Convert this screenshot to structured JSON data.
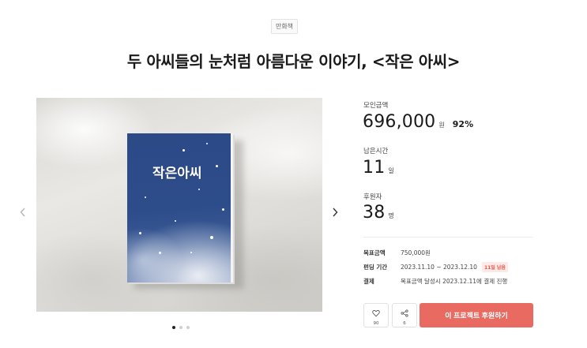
{
  "category": "만화책",
  "title": "두 아씨들의 눈처럼 아름다운 이야기, <작은 아씨>",
  "gallery": {
    "book_title": "작은아씨",
    "prev_icon": "chevron-left-icon",
    "next_icon": "chevron-right-icon",
    "dots": 3,
    "active_dot": 0
  },
  "stats": {
    "amount_label": "모인금액",
    "amount": "696,000",
    "amount_unit": "원",
    "percent": "92%",
    "time_label": "남은시간",
    "days": "11",
    "days_unit": "일",
    "backers_label": "후원자",
    "backers": "38",
    "backers_unit": "명"
  },
  "info": {
    "goal_label": "목표금액",
    "goal_value": "750,000원",
    "period_label": "펀딩 기간",
    "period_value": "2023.11.10 ~ 2023.12.10",
    "remaining_badge": "11일 남음",
    "payment_label": "결제",
    "payment_value": "목표금액 달성시 2023.12.11에 결제 진행"
  },
  "actions": {
    "like_icon": "heart-icon",
    "like_count": "90",
    "share_icon": "share-icon",
    "share_count": "6",
    "support_label": "이 프로젝트 후원하기"
  },
  "colors": {
    "accent": "#e86a61",
    "badge_text": "#e4574a",
    "book_cover": "#2c4a86"
  }
}
